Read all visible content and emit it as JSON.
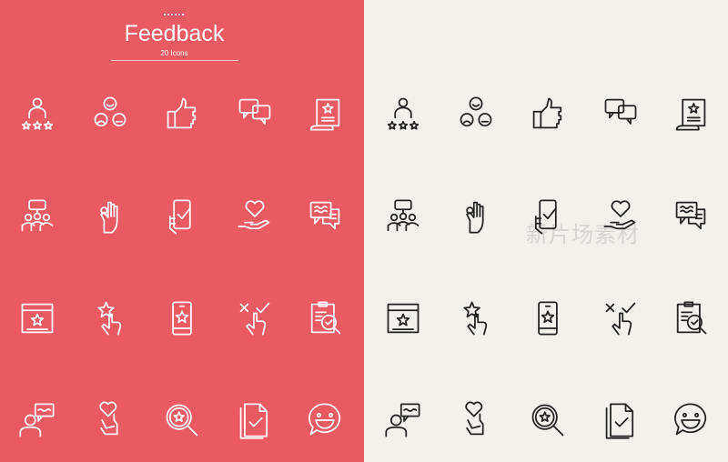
{
  "header": {
    "title": "Feedback",
    "subtitle": "20 Icons"
  },
  "colors": {
    "left_bg": "#EA5A62",
    "right_bg": "#F3F1EC",
    "left_icon": "#FFFFFF",
    "right_icon": "#222222"
  },
  "icons": [
    "person-rating-stars-icon",
    "emoji-faces-icon",
    "thumbs-up-icon",
    "chat-bubbles-icon",
    "certificate-scroll-icon",
    "group-chat-icon",
    "ok-hand-icon",
    "phone-check-hand-icon",
    "heart-in-hand-icon",
    "chat-message-icon",
    "browser-star-icon",
    "star-touch-icon",
    "phone-star-icon",
    "cross-check-touch-icon",
    "clipboard-search-icon",
    "person-chat-icon",
    "heart-hand-icon",
    "magnifier-star-icon",
    "document-check-icon",
    "smiley-chat-icon"
  ],
  "watermark": "新片场素材"
}
